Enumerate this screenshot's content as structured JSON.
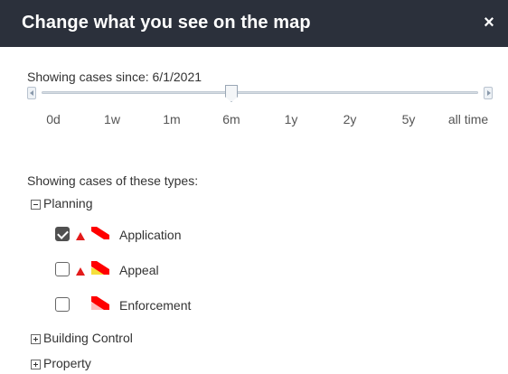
{
  "header": {
    "title": "Change what you see on the map",
    "close_label": "×"
  },
  "time_filter": {
    "label": "Showing cases since: 6/1/2021",
    "selected": "6m",
    "ticks": [
      "0d",
      "1w",
      "1m",
      "6m",
      "1y",
      "2y",
      "5y",
      "all time"
    ]
  },
  "types_filter": {
    "label": "Showing cases of these types:",
    "groups": [
      {
        "label": "Planning",
        "expanded": true,
        "items": [
          {
            "label": "Application",
            "checked": true,
            "warning_icon": "red-triangle-icon",
            "symbol": "red-stripe-icon",
            "symbol_colors": [
              "#ff0000"
            ]
          },
          {
            "label": "Appeal",
            "checked": false,
            "warning_icon": "red-triangle-icon",
            "symbol": "red-yellow-stripe-icon",
            "symbol_colors": [
              "#ff0000",
              "#f5df3c"
            ]
          },
          {
            "label": "Enforcement",
            "checked": false,
            "warning_icon": null,
            "symbol": "red-pink-stripe-icon",
            "symbol_colors": [
              "#ff0000",
              "#ffbdbd"
            ]
          }
        ]
      },
      {
        "label": "Building Control",
        "expanded": false
      },
      {
        "label": "Property",
        "expanded": false
      }
    ]
  },
  "colors": {
    "header_bg": "#2b303b",
    "accent_red": "#e31b1b"
  }
}
